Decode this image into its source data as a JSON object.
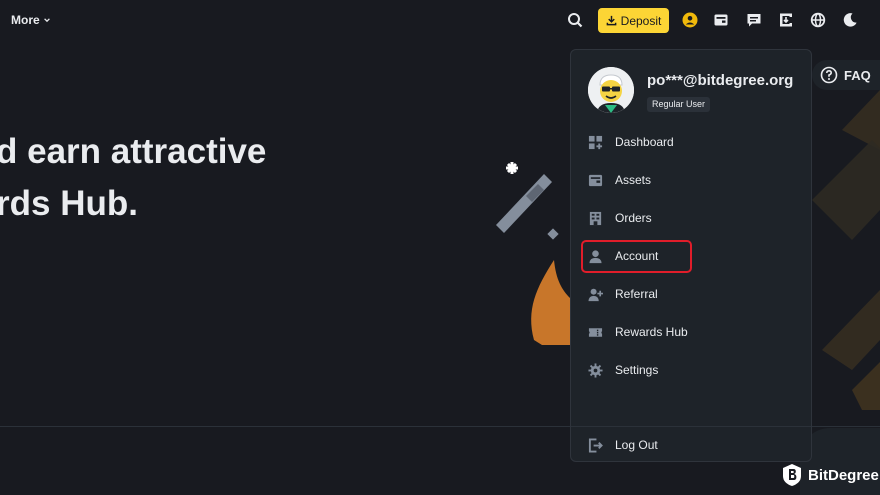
{
  "header": {
    "more_label": "More",
    "deposit_label": "Deposit"
  },
  "hero": {
    "line1": "d earn attractive",
    "line2": "rds Hub."
  },
  "faq_label": "FAQ",
  "account_menu": {
    "email": "po***@bitdegree.org",
    "user_level": "Regular User",
    "items": [
      {
        "label": "Dashboard",
        "icon": "dashboard-icon"
      },
      {
        "label": "Assets",
        "icon": "wallet-icon"
      },
      {
        "label": "Orders",
        "icon": "orders-icon"
      },
      {
        "label": "Account",
        "icon": "user-icon"
      },
      {
        "label": "Referral",
        "icon": "add-user-icon"
      },
      {
        "label": "Rewards Hub",
        "icon": "ticket-icon"
      },
      {
        "label": "Settings",
        "icon": "gear-icon"
      }
    ],
    "logout_label": "Log Out",
    "highlighted_item": "Account"
  },
  "watermark": {
    "brand": "BitDegree"
  },
  "colors": {
    "background": "#181a20",
    "panel": "#1e2329",
    "accent_yellow": "#fcd535",
    "highlight_red": "#e11d2a",
    "decor_orange": "#c8762a"
  }
}
